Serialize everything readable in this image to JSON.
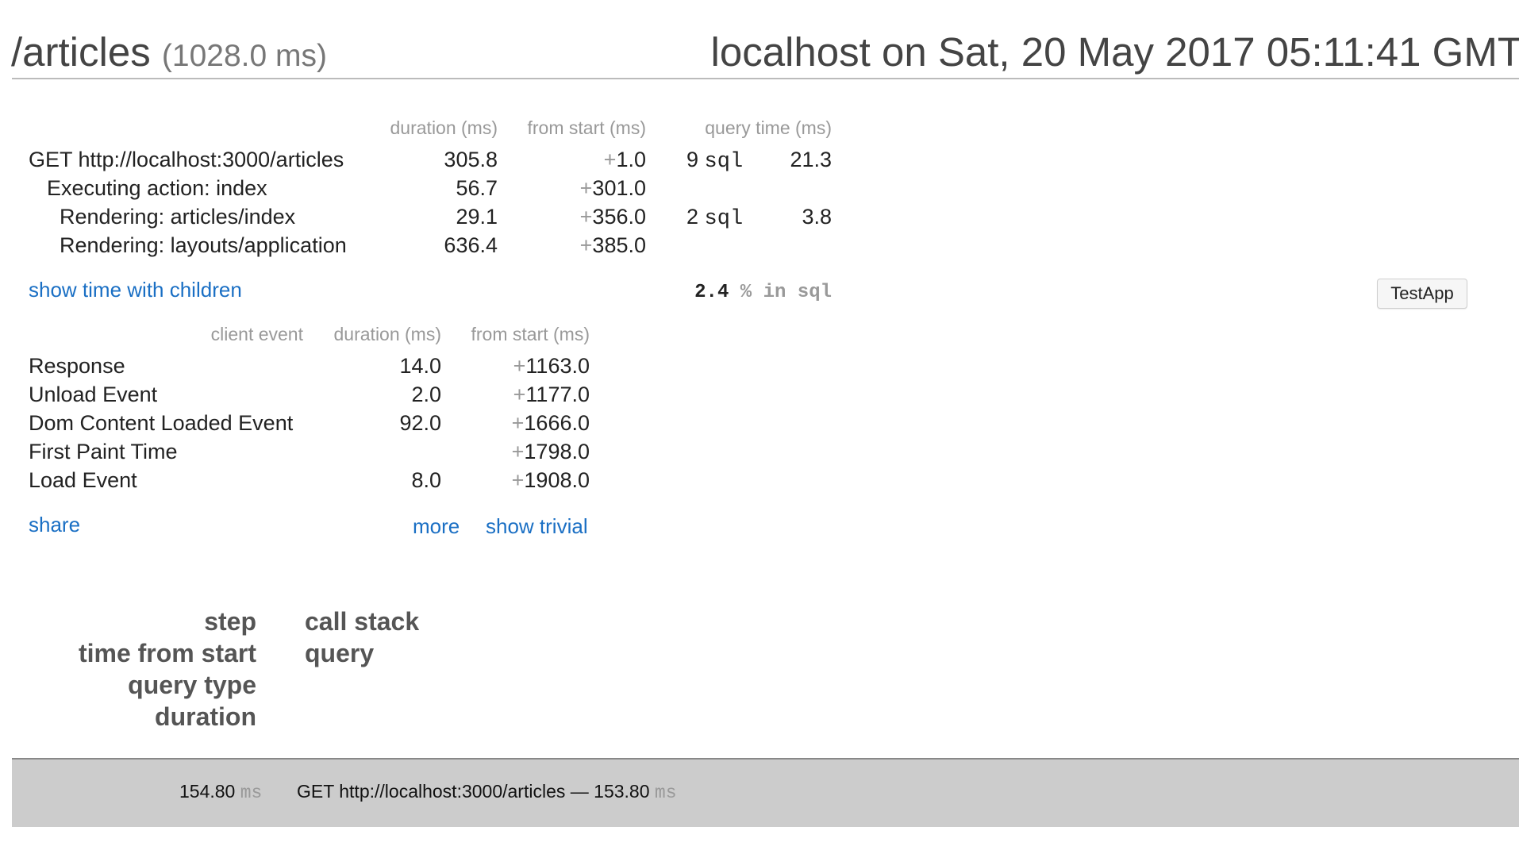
{
  "header": {
    "path": "/articles",
    "duration": "(1028.0 ms)",
    "server_time": "localhost on Sat, 20 May 2017 05:11:41 GMT"
  },
  "timings": {
    "headers": {
      "duration": "duration (ms)",
      "from_start": "from start (ms)",
      "query_time": "query time (ms)"
    },
    "rows": [
      {
        "label": "GET http://localhost:3000/articles",
        "duration": "305.8",
        "from_start": "1.0",
        "sql_count": "9",
        "sql_word": "sql",
        "query_time": "21.3"
      },
      {
        "label": "Executing action: index",
        "duration": "56.7",
        "from_start": "301.0",
        "sql_count": "",
        "sql_word": "",
        "query_time": ""
      },
      {
        "label": "Rendering: articles/index",
        "duration": "29.1",
        "from_start": "356.0",
        "sql_count": "2",
        "sql_word": "sql",
        "query_time": "3.8"
      },
      {
        "label": "Rendering: layouts/application",
        "duration": "636.4",
        "from_start": "385.0",
        "sql_count": "",
        "sql_word": "",
        "query_time": ""
      }
    ],
    "plus_sign": "+",
    "show_children_link": "show time with children",
    "sql_percent": {
      "value": "2.4",
      "suffix": "% in sql"
    }
  },
  "client_events": {
    "headers": {
      "event": "client event",
      "duration": "duration (ms)",
      "from_start": "from start (ms)"
    },
    "rows": [
      {
        "label": "Response",
        "duration": "14.0",
        "from_start": "1163.0"
      },
      {
        "label": "Unload Event",
        "duration": "2.0",
        "from_start": "1177.0"
      },
      {
        "label": "Dom Content Loaded Event",
        "duration": "92.0",
        "from_start": "1666.0"
      },
      {
        "label": "First Paint Time",
        "duration": "",
        "from_start": "1798.0"
      },
      {
        "label": "Load Event",
        "duration": "8.0",
        "from_start": "1908.0"
      }
    ]
  },
  "links": {
    "share": "share",
    "more": "more",
    "show_trivial": "show trivial"
  },
  "testapp_button": "TestApp",
  "query_columns": {
    "left": [
      "step",
      "time from start",
      "query type",
      "duration"
    ],
    "right": [
      "call stack",
      "query"
    ]
  },
  "footer": {
    "total_time": "154.80",
    "unit": "ms",
    "request": "GET http://localhost:3000/articles",
    "dash": "—",
    "request_time": "153.80"
  }
}
